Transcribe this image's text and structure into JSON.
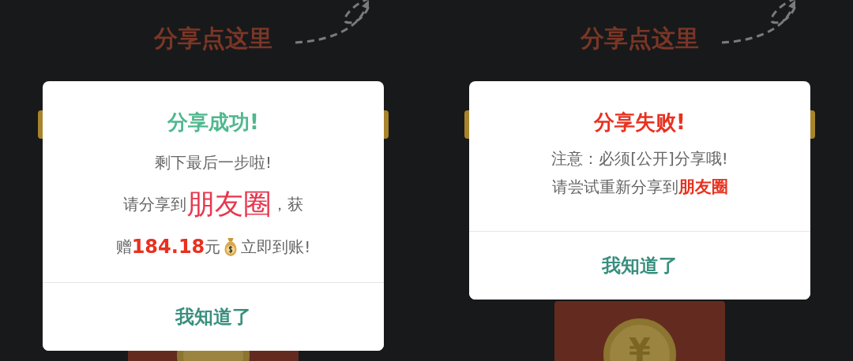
{
  "panels": [
    {
      "hint": "分享点这里",
      "dialog": {
        "kind": "success",
        "title": "分享成功!",
        "lines": [
          [
            {
              "kind": "plain",
              "text": "剩下最后一步啦!"
            }
          ],
          [
            {
              "kind": "plain",
              "text": "请分享到"
            },
            {
              "kind": "big",
              "text": "朋友圈"
            },
            {
              "kind": "plain",
              "text": "，获"
            }
          ],
          [
            {
              "kind": "plain",
              "text": "赠"
            },
            {
              "kind": "amount",
              "text": "184.18"
            },
            {
              "kind": "plain",
              "text": "元"
            },
            {
              "kind": "moneybag"
            },
            {
              "kind": "plain",
              "text": "立即到账!"
            }
          ]
        ],
        "button": "我知道了"
      }
    },
    {
      "hint": "分享点这里",
      "coin_symbol": "¥",
      "dialog": {
        "kind": "failure",
        "title": "分享失败!",
        "lines": [
          [
            {
              "kind": "plain",
              "text": "注意：必须[公开]分享哦!"
            }
          ],
          [
            {
              "kind": "plain",
              "text": "请尝试重新分享到"
            },
            {
              "kind": "strong",
              "text": "朋友圈"
            }
          ]
        ],
        "button": "我知道了"
      }
    }
  ]
}
